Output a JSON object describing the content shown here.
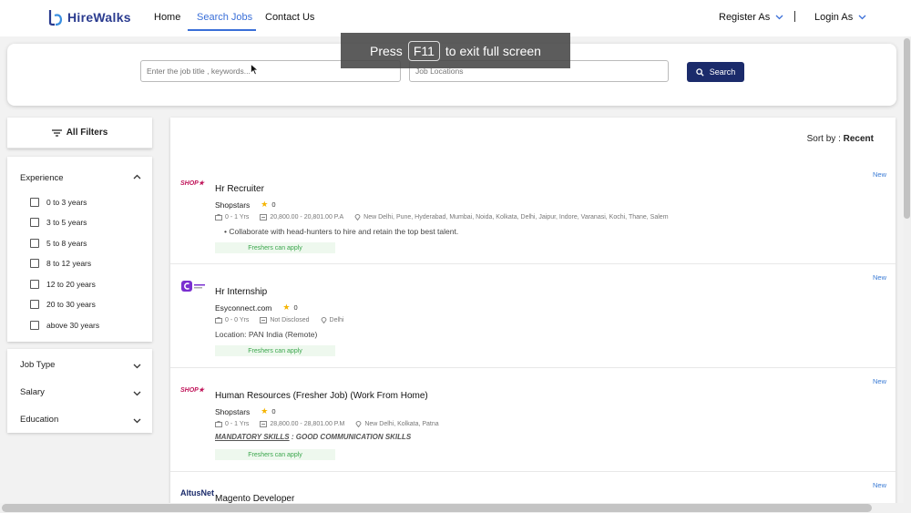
{
  "nav": {
    "brand": "HireWalks",
    "links": [
      "Home",
      "Search Jobs",
      "Contact Us"
    ],
    "register": "Register As",
    "login": "Login As",
    "accent": "#3a6fd8"
  },
  "search": {
    "keyword_placeholder": "Enter the job title , keywords...",
    "location_placeholder": "Job Locations",
    "button": "Search",
    "button_color": "#1b2b6b"
  },
  "overlay": {
    "pre": "Press",
    "key": "F11",
    "post": "to exit full screen"
  },
  "filters": {
    "title": "All Filters",
    "experience": {
      "label": "Experience",
      "options": [
        "0 to 3 years",
        "3 to 5 years",
        "5 to 8 years",
        "8 to 12 years",
        "12 to 20 years",
        "20 to 30 years",
        "above 30 years"
      ]
    },
    "collapsed": [
      "Job Type",
      "Salary",
      "Education"
    ]
  },
  "results": {
    "sort_label": "Sort by :",
    "sort_value": "Recent",
    "jobs": [
      {
        "title": "Hr Recruiter",
        "company": "Shopstars",
        "logo_text": "SHOP★",
        "rating": "0",
        "experience": "0 - 1 Yrs",
        "salary": "20,800.00 - 20,801.00 P.A",
        "location": "New Delhi, Pune, Hyderabad, Mumbai, Noida, Kolkata, Delhi, Jaipur, Indore, Varanasi, Kochi, Thane, Salem",
        "description": "•   Collaborate with head-hunters to hire and retain the top best talent.",
        "tag": "Freshers can apply",
        "badge": "New"
      },
      {
        "title": "Hr Internship",
        "company": "Esyconnect.com",
        "logo_text": "C",
        "rating": "0",
        "experience": "0 - 0 Yrs",
        "salary": "Not Disclosed",
        "location": "Delhi",
        "description": "Location: PAN India (Remote)",
        "tag": "Freshers can apply",
        "badge": "New"
      },
      {
        "title": "Human Resources (Fresher Job) (Work From Home)",
        "company": "Shopstars",
        "logo_text": "SHOP★",
        "rating": "0",
        "experience": "0 - 1 Yrs",
        "salary": "28,800.00 - 28,801.00 P.M",
        "location": "New Delhi, Kolkata, Patna",
        "description_u": "MANDATORY SKILLS",
        "description_rest": " : GOOD COMMUNICATION SKILLS",
        "tag": "Freshers can apply",
        "badge": "New"
      },
      {
        "title": "Magento Developer",
        "logo_text": "AltusNet",
        "badge": "New"
      }
    ]
  }
}
